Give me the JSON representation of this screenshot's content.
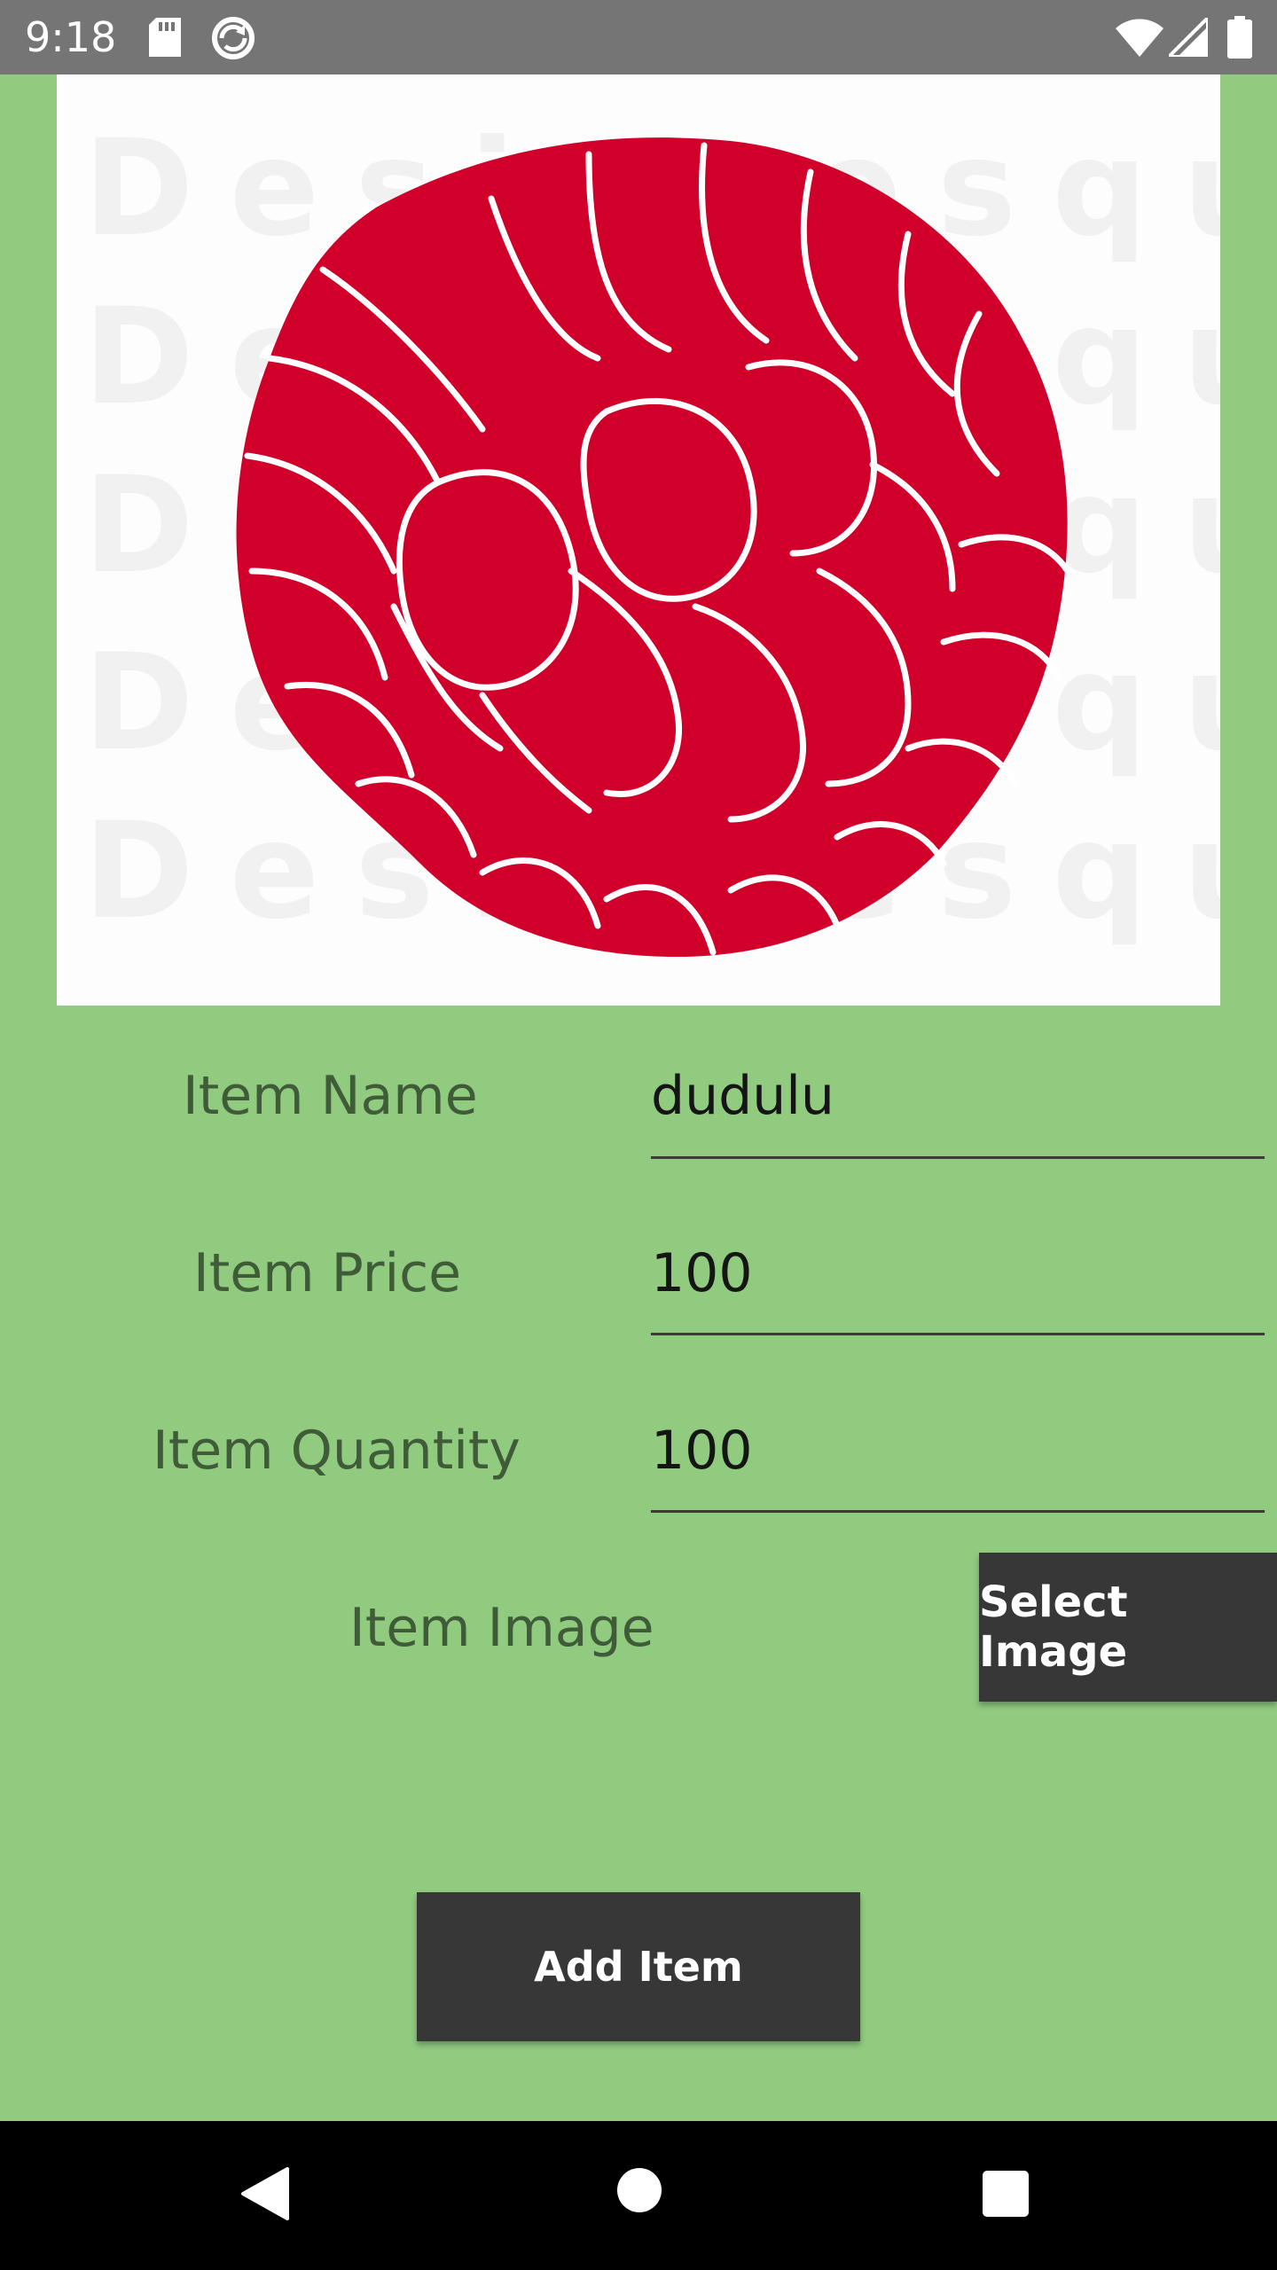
{
  "status_bar": {
    "time": "9:18",
    "icons": [
      "sd-card-icon",
      "sync-icon",
      "wifi-icon",
      "signal-icon",
      "battery-icon"
    ]
  },
  "image_preview": {
    "watermark": "Designesque",
    "subject": "raspberry"
  },
  "form": {
    "name": {
      "label": "Item Name",
      "value": "dudulu"
    },
    "price": {
      "label": "Item Price",
      "value": "100"
    },
    "quantity": {
      "label": "Item Quantity",
      "value": "100"
    },
    "image": {
      "label": "Item Image",
      "button": "Select Image"
    }
  },
  "actions": {
    "add_button": "Add Item"
  },
  "nav_bar": {
    "icons": [
      "back-icon",
      "home-icon",
      "recents-icon"
    ]
  },
  "colors": {
    "background": "#90cb80",
    "status_bar": "#757575",
    "button": "#373737",
    "label_text": "#3f5b38",
    "raspberry_red": "#d0002a",
    "nav_bar": "#000000"
  }
}
